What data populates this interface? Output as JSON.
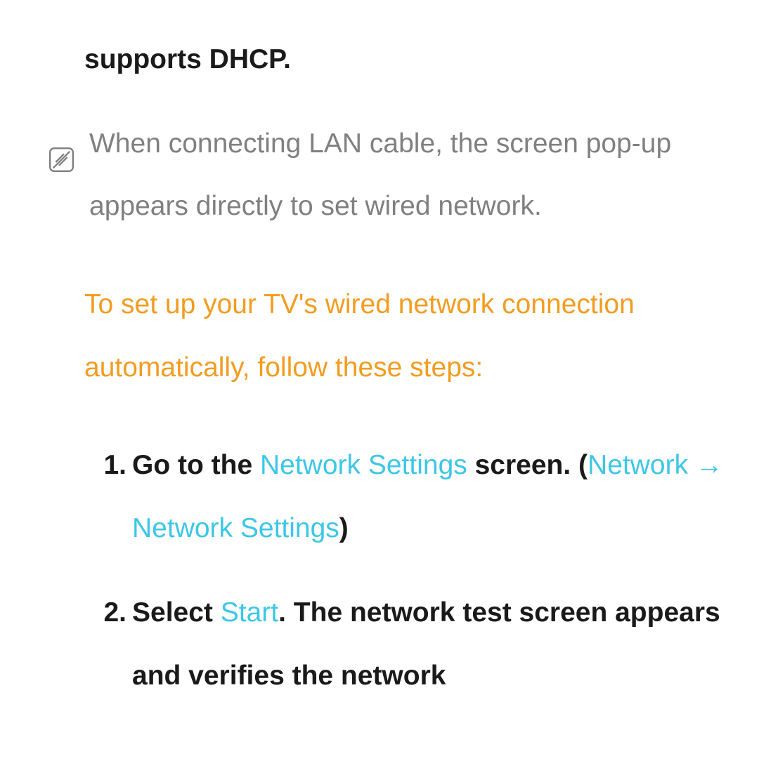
{
  "fragment": "supports DHCP.",
  "note": "When connecting LAN cable, the screen pop-up appears directly to set wired network.",
  "heading": "To set up your TV's wired network connection automatically, follow these steps:",
  "steps": {
    "s1": {
      "num": "1.",
      "t1": "Go to the ",
      "link1": "Network Settings",
      "t2": " screen. (",
      "link2": "Network",
      "arrow": " → ",
      "link3": "Network Settings",
      "t3": ")"
    },
    "s2": {
      "num": "2.",
      "t1": "Select ",
      "link1": "Start",
      "t2": ". The network test screen appears and verifies the network"
    }
  }
}
